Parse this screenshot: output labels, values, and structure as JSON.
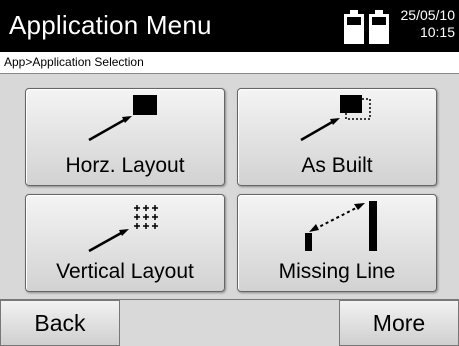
{
  "header": {
    "title": "Application Menu",
    "date": "25/05/10",
    "time": "10:15"
  },
  "breadcrumb": "App>Application Selection",
  "apps": [
    {
      "label": "Horz. Layout",
      "icon": "horizontal-layout-icon"
    },
    {
      "label": "As Built",
      "icon": "as-built-icon"
    },
    {
      "label": "Vertical Layout",
      "icon": "vertical-layout-icon"
    },
    {
      "label": "Missing Line",
      "icon": "missing-line-icon"
    }
  ],
  "softkeys": {
    "back": "Back",
    "more": "More"
  }
}
